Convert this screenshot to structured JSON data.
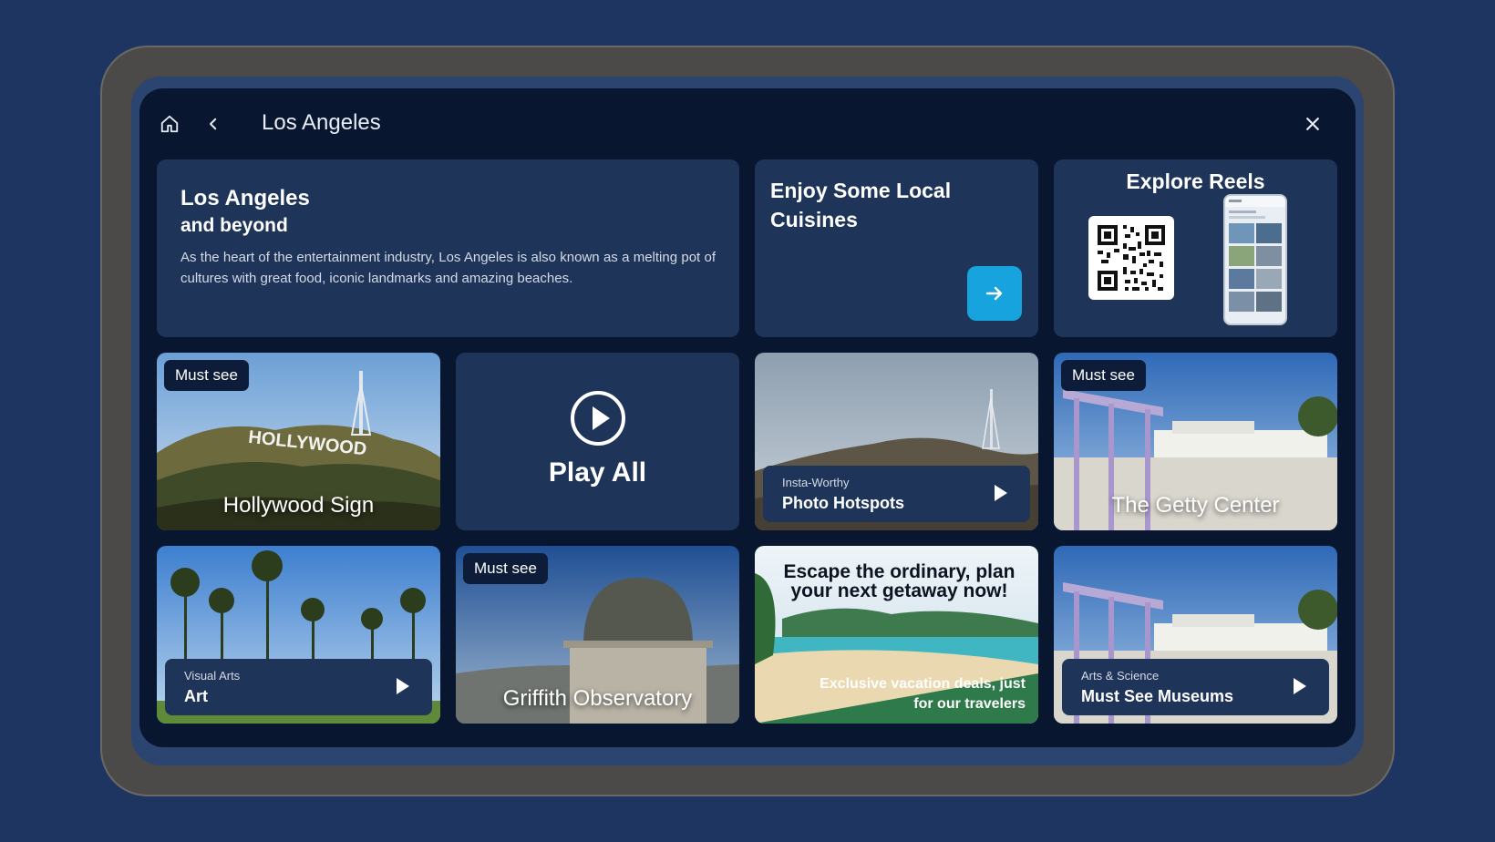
{
  "header": {
    "title": "Los Angeles"
  },
  "hero": {
    "title": "Los Angeles",
    "subtitle": "and beyond",
    "description": "As the heart of the entertainment industry, Los Angeles is also known as a melting pot of cultures with great food, iconic landmarks and amazing beaches."
  },
  "cuisine": {
    "title": "Enjoy Some Local Cuisines"
  },
  "reels": {
    "title": "Explore Reels"
  },
  "tiles": {
    "hollywood": {
      "badge": "Must see",
      "label": "Hollywood Sign"
    },
    "play_all": {
      "label": "Play All"
    },
    "photo": {
      "category": "Insta-Worthy",
      "name": "Photo Hotspots"
    },
    "getty": {
      "badge": "Must see",
      "label": "The Getty Center"
    },
    "art": {
      "category": "Visual Arts",
      "name": "Art"
    },
    "griffith": {
      "badge": "Must see",
      "label": "Griffith Observatory"
    },
    "promo": {
      "headline": "Escape the ordinary, plan your next getaway now!",
      "tagline": "Exclusive vacation deals, just for our travelers"
    },
    "museums": {
      "category": "Arts & Science",
      "name": "Must See Museums"
    }
  },
  "colors": {
    "background": "#1d3560",
    "screen": "#081630",
    "card": "#1e3458",
    "accent": "#17a3dd"
  },
  "icons": [
    "home-icon",
    "chevron-left-icon",
    "close-icon",
    "arrow-right-icon",
    "play-circle-icon",
    "play-icon",
    "qr-code-icon"
  ]
}
